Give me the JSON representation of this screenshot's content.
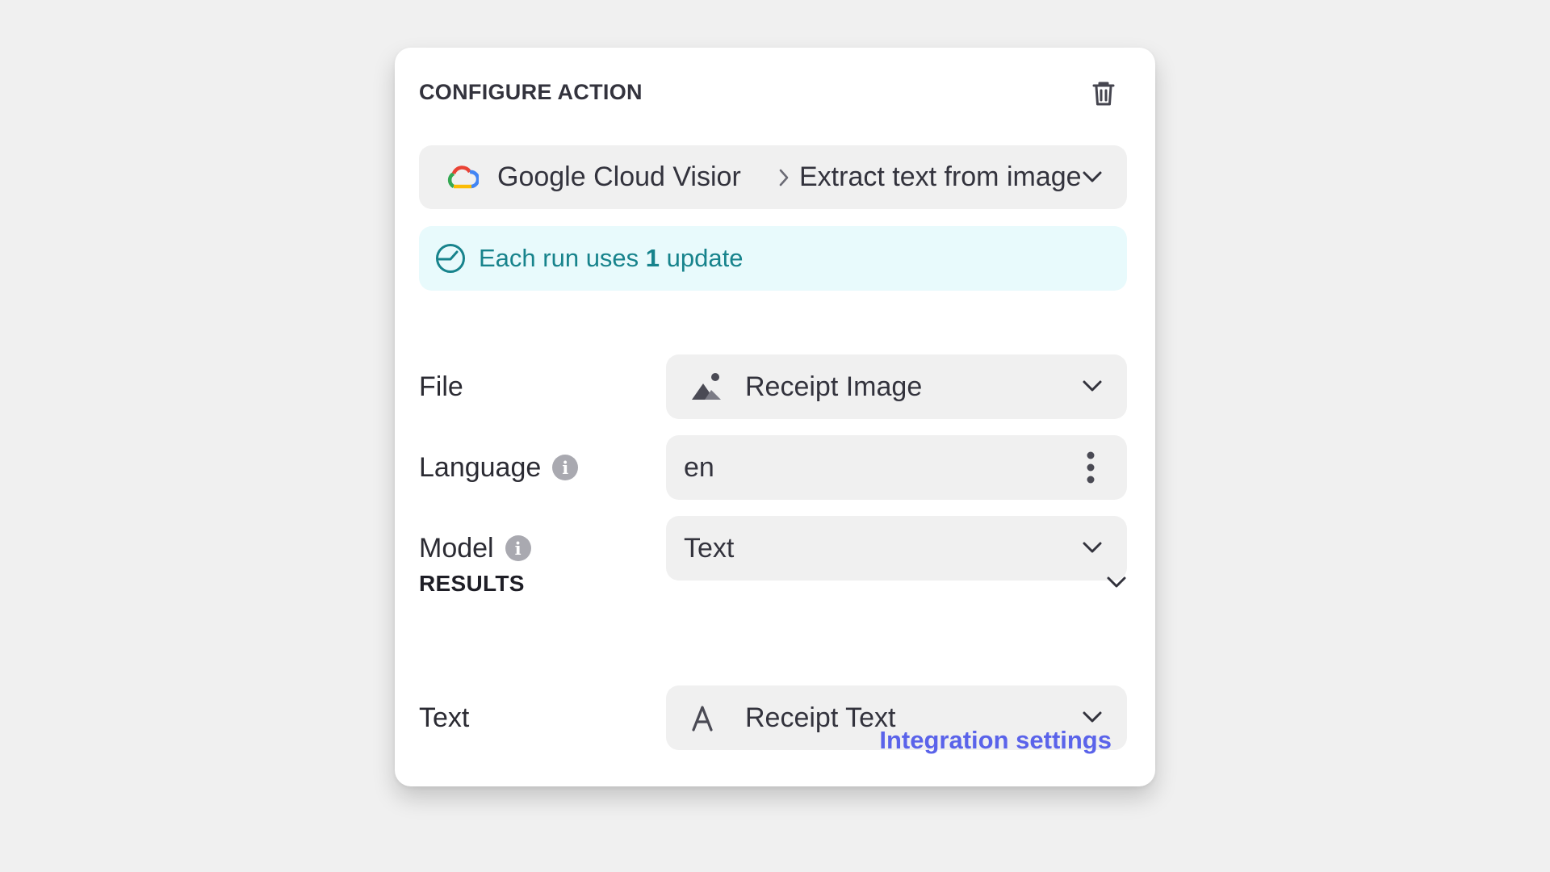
{
  "header": {
    "title": "CONFIGURE ACTION",
    "delete_icon": "trash-icon"
  },
  "action_selector": {
    "service_icon": "google-cloud-logo",
    "service": "Google Cloud Visior",
    "separator_icon": "chevron-right-icon",
    "action": "Extract text from image",
    "dropdown_icon": "chevron-down-icon"
  },
  "usage_banner": {
    "icon": "gauge-icon",
    "prefix": "Each run uses ",
    "count": "1",
    "suffix": " update",
    "color": "#17838c",
    "background": "#e8fafc"
  },
  "fields": {
    "file": {
      "label": "File",
      "icon": "image-icon",
      "value": "Receipt Image"
    },
    "language": {
      "label": "Language",
      "info_icon": "info-icon",
      "value": "en",
      "menu_icon": "more-vertical-icon"
    },
    "model": {
      "label": "Model",
      "info_icon": "info-icon",
      "value": "Text"
    }
  },
  "results": {
    "title": "RESULTS",
    "toggle_icon": "chevron-down-icon",
    "text": {
      "label": "Text",
      "icon": "text-type-icon",
      "value": "Receipt Text"
    }
  },
  "footer": {
    "link": "Integration settings",
    "link_color": "#5a63ea"
  }
}
